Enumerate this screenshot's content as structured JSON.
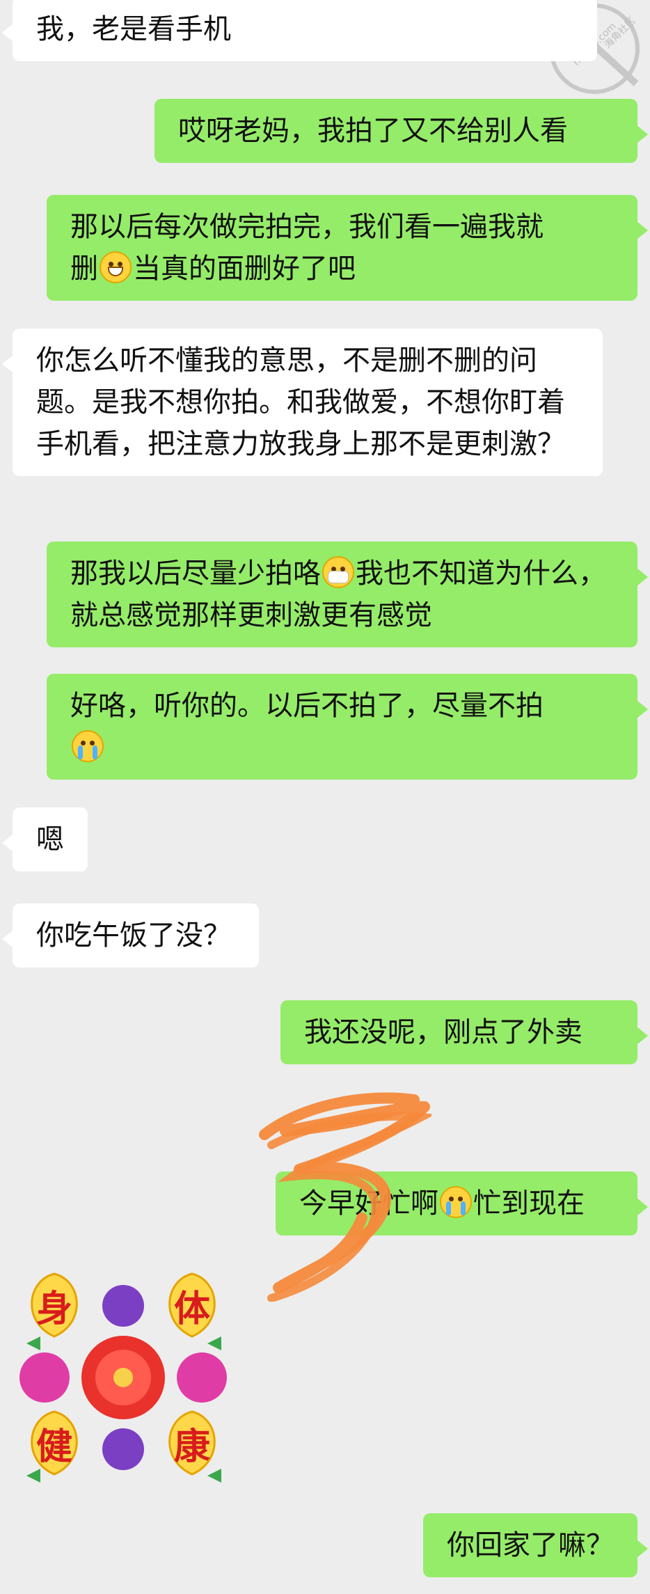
{
  "messages": [
    {
      "side": "left",
      "text": "我，老是看手机"
    },
    {
      "side": "right",
      "text": "哎呀老妈，我拍了又不给别人看"
    },
    {
      "side": "right",
      "line1": "那以后每次做完拍完，我们看一遍我就",
      "line2_pre": "删",
      "emoji": "grin-emoji",
      "line2_post": "当真的面删好了吧"
    },
    {
      "side": "left",
      "text": "你怎么听不懂我的意思，不是删不删的问题。是我不想你拍。和我做爱，不想你盯着手机看，把注意力放我身上那不是更刺激？"
    },
    {
      "side": "right",
      "pre": "那我以后尽量少拍咯",
      "emoji": "mask-emoji",
      "post": "我也不知道为什么，就总感觉那样更刺激更有感觉"
    },
    {
      "side": "right",
      "text": "好咯，听你的。以后不拍了，尽量不拍",
      "emoji": "crying-emoji"
    },
    {
      "side": "left",
      "text": "嗯"
    },
    {
      "side": "left",
      "text": "你吃午饭了没？"
    },
    {
      "side": "right",
      "text": "我还没呢，刚点了外卖"
    },
    {
      "side": "right",
      "pre": "今早好忙啊",
      "emoji": "crying-emoji",
      "post": "忙到现在"
    },
    {
      "side": "right",
      "text": "你回家了嘛？"
    }
  ],
  "sticker": {
    "chars": [
      "身",
      "体",
      "健",
      "康"
    ],
    "name": "health-sticker"
  },
  "watermark": {
    "line1": "海角社区",
    "line2": "haijiao.com"
  },
  "colors": {
    "background": "#ededed",
    "received": "#ffffff",
    "sent": "#95ec69",
    "scribble": "#f58a3c"
  }
}
